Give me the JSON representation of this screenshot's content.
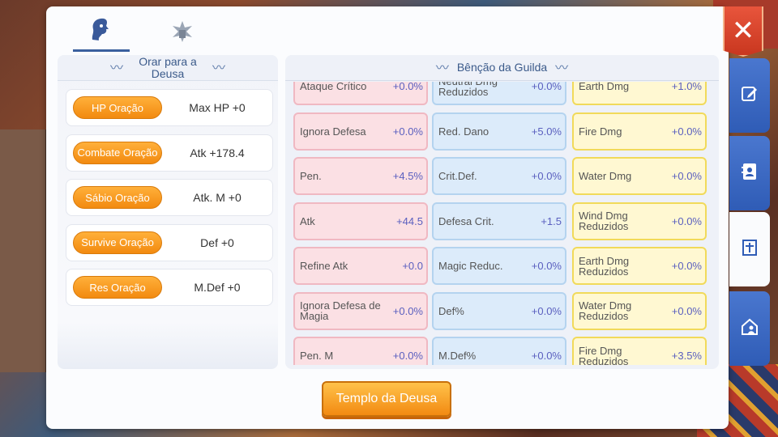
{
  "tabs": [
    {
      "name": "goddess-tab",
      "icon": "goddess-head-icon",
      "active": true
    },
    {
      "name": "guild-tab",
      "icon": "guild-emblem-icon",
      "active": false
    }
  ],
  "left": {
    "title": "Orar para a Deusa",
    "rows": [
      {
        "button": "HP Oração",
        "value": "Max HP  +0"
      },
      {
        "button": "Combate Oração",
        "value": "Atk +178.4"
      },
      {
        "button": "Sábio Oração",
        "value": "Atk. M +0"
      },
      {
        "button": "Survive Oração",
        "value": "Def +0"
      },
      {
        "button": "Res Oração",
        "value": "M.Def +0"
      }
    ]
  },
  "right": {
    "title": "Bênção da Guilda",
    "col1": [
      {
        "name": "Ataque Crítico",
        "value": "+0.0%"
      },
      {
        "name": "Ignora Defesa",
        "value": "+0.0%"
      },
      {
        "name": "Pen.",
        "value": "+4.5%"
      },
      {
        "name": "Atk",
        "value": "+44.5"
      },
      {
        "name": "Refine Atk",
        "value": "+0.0"
      },
      {
        "name": "Ignora Defesa de Magia",
        "value": "+0.0%"
      },
      {
        "name": "Pen. M",
        "value": "+0.0%"
      }
    ],
    "col2": [
      {
        "name": "Neutral Dmg Reduzidos",
        "value": "+0.0%"
      },
      {
        "name": "Red. Dano",
        "value": "+5.0%"
      },
      {
        "name": "Crit.Def.",
        "value": "+0.0%"
      },
      {
        "name": "Defesa Crit.",
        "value": "+1.5"
      },
      {
        "name": "Magic Reduc.",
        "value": "+0.0%"
      },
      {
        "name": "Def%",
        "value": "+0.0%"
      },
      {
        "name": "M.Def%",
        "value": "+0.0%"
      }
    ],
    "col3": [
      {
        "name": "Earth Dmg",
        "value": "+1.0%"
      },
      {
        "name": "Fire Dmg",
        "value": "+0.0%"
      },
      {
        "name": "Water Dmg",
        "value": "+0.0%"
      },
      {
        "name": "Wind Dmg Reduzidos",
        "value": "+0.0%"
      },
      {
        "name": "Earth Dmg Reduzidos",
        "value": "+0.0%"
      },
      {
        "name": "Water Dmg Reduzidos",
        "value": "+0.0%"
      },
      {
        "name": "Fire Dmg Reduzidos",
        "value": "+3.5%"
      }
    ]
  },
  "temple_button": "Templo da Deusa",
  "close_label": "✕",
  "side_tabs": [
    {
      "icon": "edit-icon",
      "active": false
    },
    {
      "icon": "contacts-book-icon",
      "active": false
    },
    {
      "icon": "cross-church-icon",
      "active": true
    },
    {
      "icon": "house-person-icon",
      "active": false
    }
  ],
  "colors": {
    "accent": "#f28a10",
    "header_text": "#3b5a8a",
    "side_tab": "#2f5cb6",
    "close": "#d9432a"
  }
}
